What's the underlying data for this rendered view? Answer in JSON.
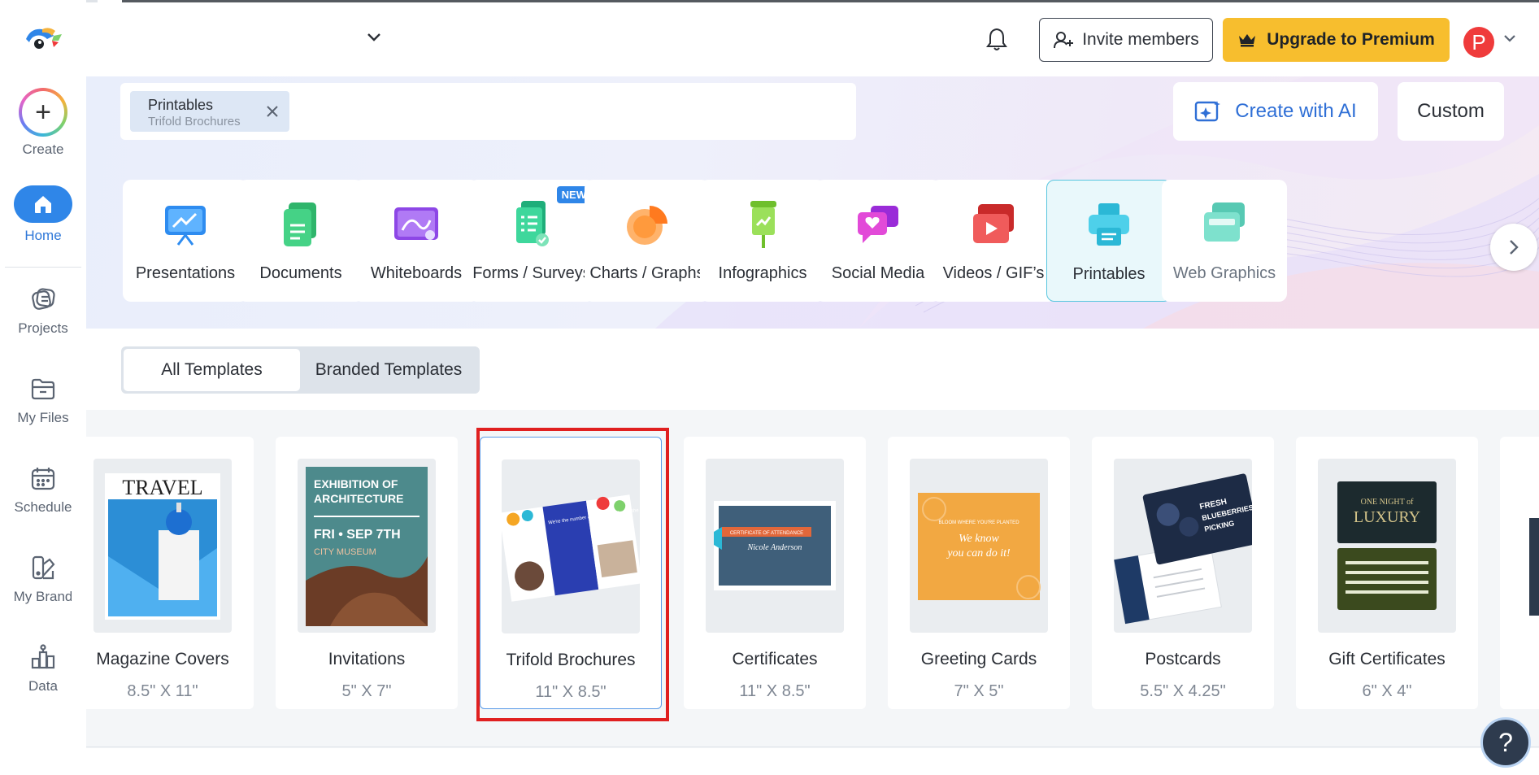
{
  "sidebar": {
    "create_label": "Create",
    "items": [
      {
        "label": "Home"
      },
      {
        "label": "Projects"
      },
      {
        "label": "My Files"
      },
      {
        "label": "Schedule"
      },
      {
        "label": "My Brand"
      },
      {
        "label": "Data"
      }
    ]
  },
  "header": {
    "invite_label": "Invite members",
    "upgrade_label": "Upgrade to Premium",
    "avatar_initial": "P"
  },
  "search": {
    "chip_title": "Printables",
    "chip_subtitle": "Trifold Brochures"
  },
  "actions": {
    "create_ai_label": "Create with AI",
    "custom_label": "Custom"
  },
  "categories": [
    {
      "label": "Presentations"
    },
    {
      "label": "Documents"
    },
    {
      "label": "Whiteboards"
    },
    {
      "label": "Forms / Surveys",
      "badge": "NEW"
    },
    {
      "label": "Charts / Graphs"
    },
    {
      "label": "Infographics"
    },
    {
      "label": "Social Media"
    },
    {
      "label": "Videos / GIF’s"
    },
    {
      "label": "Printables",
      "selected": true
    },
    {
      "label": "Web Graphics"
    }
  ],
  "tabs": [
    {
      "label": "All Templates",
      "active": true
    },
    {
      "label": "Branded Templates",
      "active": false
    }
  ],
  "templates": [
    {
      "name": "Magazine Covers",
      "size": "8.5\" X 11\"",
      "thumb_text": [
        "TRAVEL"
      ]
    },
    {
      "name": "Invitations",
      "size": "5\" X 7\"",
      "thumb_text": [
        "EXHIBITION OF",
        "ARCHITECTURE",
        "FRI • SEP 7TH",
        "CITY MUSEUM"
      ]
    },
    {
      "name": "Trifold Brochures",
      "size": "11\" X 8.5\"",
      "selected": true,
      "thumb_text": [
        "We're the number #1 consulting firm in the country"
      ]
    },
    {
      "name": "Certificates",
      "size": "11\" X 8.5\"",
      "thumb_text": [
        "CERTIFICATE OF ATTENDANCE",
        "Nicole Anderson"
      ]
    },
    {
      "name": "Greeting Cards",
      "size": "7\" X 5\"",
      "thumb_text": [
        "BLOOM WHERE YOU'RE PLANTED",
        "We know",
        "you can do it!"
      ]
    },
    {
      "name": "Postcards",
      "size": "5.5\" X 4.25\"",
      "thumb_text": [
        "FRESH",
        "BLUEBERRIES",
        "PICKING"
      ]
    },
    {
      "name": "Gift Certificates",
      "size": "6\" X 4\"",
      "thumb_text": [
        "ONE NIGHT of",
        "LUXURY"
      ]
    }
  ],
  "help_label": "?",
  "colors": {
    "accent_blue": "#2f86e8",
    "upgrade_yellow": "#f7be2e",
    "avatar_red": "#ef3b3b",
    "highlight_red": "#e02020"
  }
}
